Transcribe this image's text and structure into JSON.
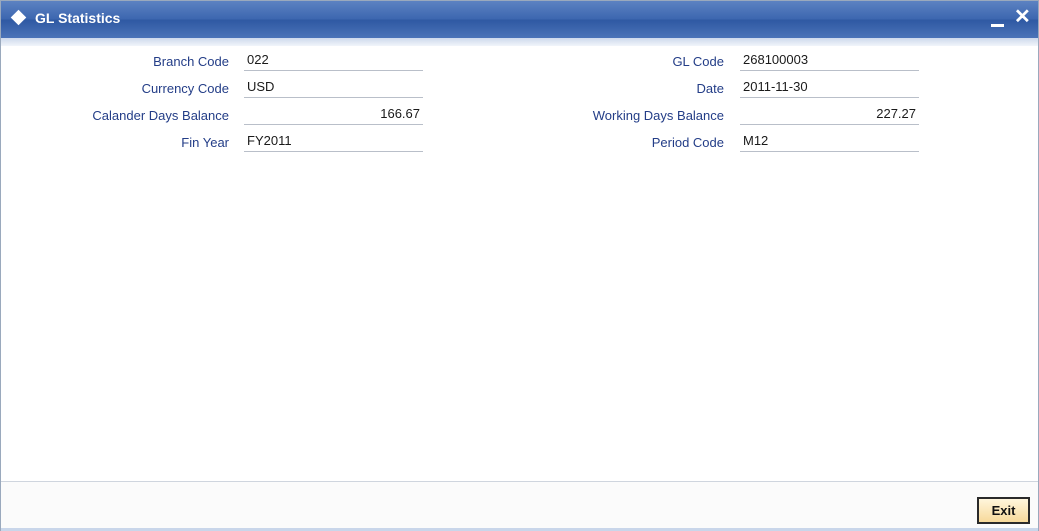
{
  "window": {
    "title": "GL Statistics",
    "minimize_label": "",
    "close_label": "✕"
  },
  "fields": {
    "branch_code": {
      "label": "Branch Code",
      "value": "022"
    },
    "currency_code": {
      "label": "Currency Code",
      "value": "USD"
    },
    "calendar_days_balance": {
      "label": "Calander Days Balance",
      "value": "166.67"
    },
    "fin_year": {
      "label": "Fin Year",
      "value": "FY2011"
    },
    "gl_code": {
      "label": "GL Code",
      "value": "268100003"
    },
    "date": {
      "label": "Date",
      "value": "2011-11-30"
    },
    "working_days_balance": {
      "label": "Working Days Balance",
      "value": "227.27"
    },
    "period_code": {
      "label": "Period Code",
      "value": "M12"
    }
  },
  "footer": {
    "exit_label": "Exit"
  },
  "colors": {
    "titlebar": "#3d67b0",
    "label_text": "#233d87",
    "exit_button_bg": "#f7d99a"
  }
}
